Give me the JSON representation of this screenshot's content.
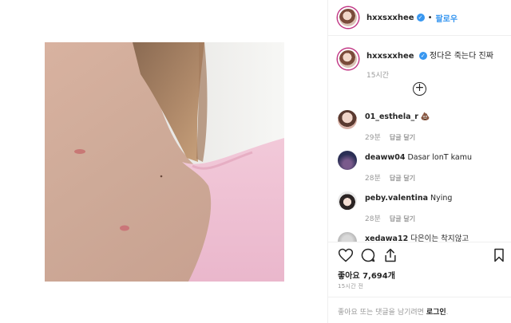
{
  "post": {
    "username": "hxxsxxhee",
    "verified_mark": "✓",
    "separator": "•",
    "follow_label": "팔로우"
  },
  "caption": {
    "username": "hxxsxxhee",
    "text": "정다은 죽는다 진짜",
    "time": "15시간",
    "load_more_symbol": "+"
  },
  "comments": [
    {
      "username": "01_esthela_r",
      "text": "💩",
      "time": "29분",
      "reply": "답글 달기",
      "avatar_color": "#d8b2a8"
    },
    {
      "username": "deaww04",
      "text": "Dasar lonT kamu",
      "time": "28분",
      "reply": "답글 달기",
      "avatar_color": "#2b2f55"
    },
    {
      "username": "peby.valentina",
      "text": "Nying",
      "time": "28분",
      "reply": "답글 달기",
      "avatar_color": "#3d3a3a"
    },
    {
      "username": "xedawa12",
      "text": "다은이는 착지않고",
      "time": "",
      "reply": "",
      "avatar_color": "#bbbbbb"
    }
  ],
  "stats": {
    "likes": "좋아요 7,694개",
    "posted": "15시간 전"
  },
  "footer": {
    "prompt": "좋아요 또는 댓글을 남기려면 ",
    "login": "로그인",
    "end": "."
  },
  "icons": [
    "heart-icon",
    "comment-icon",
    "share-icon",
    "bookmark-icon"
  ],
  "colors": {
    "accent": "#3897f0",
    "muted": "#999999",
    "text": "#262626"
  }
}
